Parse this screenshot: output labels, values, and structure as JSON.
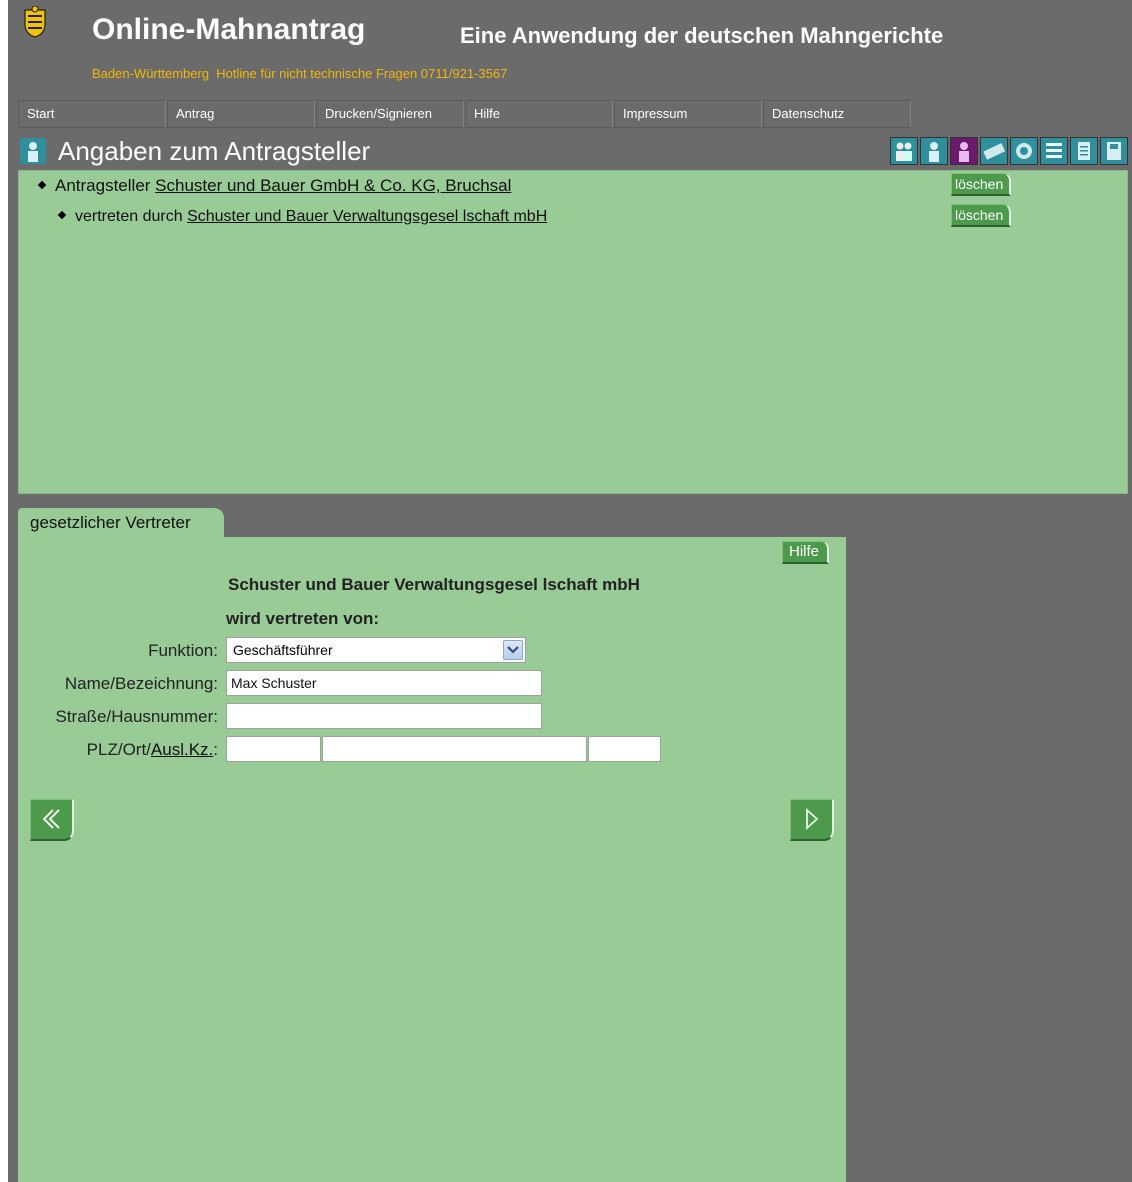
{
  "header": {
    "title": "Online-Mahnantrag",
    "subtitle": "Eine Anwendung der deutschen Mahngerichte",
    "state": "Baden-Württemberg",
    "hotline": "Hotline für nicht technische Fragen 0711/921-3567"
  },
  "nav": [
    "Start",
    "Antrag",
    "Drucken/Signieren",
    "Hilfe",
    "Impressum",
    "Datenschutz"
  ],
  "section": {
    "title": "Angaben zum Antragsteller"
  },
  "list": {
    "row1_prefix": "Antragsteller",
    "row1_link": "Schuster und Bauer GmbH & Co. KG, Bruchsal",
    "row2_prefix": "vertreten durch",
    "row2_link": "Schuster und Bauer Verwaltungsgesel lschaft mbH",
    "delete_label": "löschen"
  },
  "tab": {
    "label": "gesetzlicher Vertreter"
  },
  "form": {
    "help_label": "Hilfe",
    "represented_name": "Schuster und Bauer Verwaltungsgesel lschaft mbH",
    "represented_by": "wird vertreten von:",
    "funktion_label": "Funktion:",
    "funktion_value": "Geschäftsführer",
    "name_label": "Name/Bezeichnung:",
    "name_value": "Max Schuster",
    "street_label": "Straße/Hausnummer:",
    "street_value": "",
    "plz_label_prefix": "PLZ/Ort/",
    "plz_label_link": "Ausl.Kz.",
    "plz_label_suffix": ":",
    "plz_value": "",
    "ort_value": "",
    "auslkz_value": ""
  },
  "colors": {
    "background": "#6b6b6b",
    "panel": "#99cb97",
    "button": "#4e9a4c",
    "hotline": "#f2b705"
  },
  "icons": [
    "crest-icon",
    "person-icon",
    "group-icon",
    "person-icon",
    "person-purple-icon",
    "money-icon",
    "coins-icon",
    "list-icon",
    "document-icon",
    "save-icon"
  ]
}
